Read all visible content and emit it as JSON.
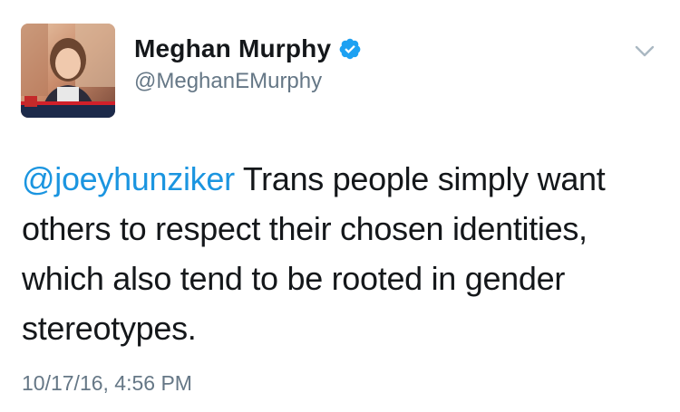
{
  "user": {
    "display_name": "Meghan Murphy",
    "handle": "@MeghanEMurphy",
    "verified": true,
    "avatar_icon": "profile-photo"
  },
  "tweet": {
    "mention": "@joeyhunziker",
    "text": " Trans people simply want others to respect their chosen identities, which also tend to be rooted in gender stereotypes.",
    "timestamp": "10/17/16, 4:56 PM"
  },
  "icons": {
    "menu": "chevron-down-icon",
    "verified": "verified-badge-icon"
  },
  "colors": {
    "link": "#1b95e0",
    "verified": "#1da1f2",
    "secondary_text": "#657786",
    "primary_text": "#14171a"
  }
}
